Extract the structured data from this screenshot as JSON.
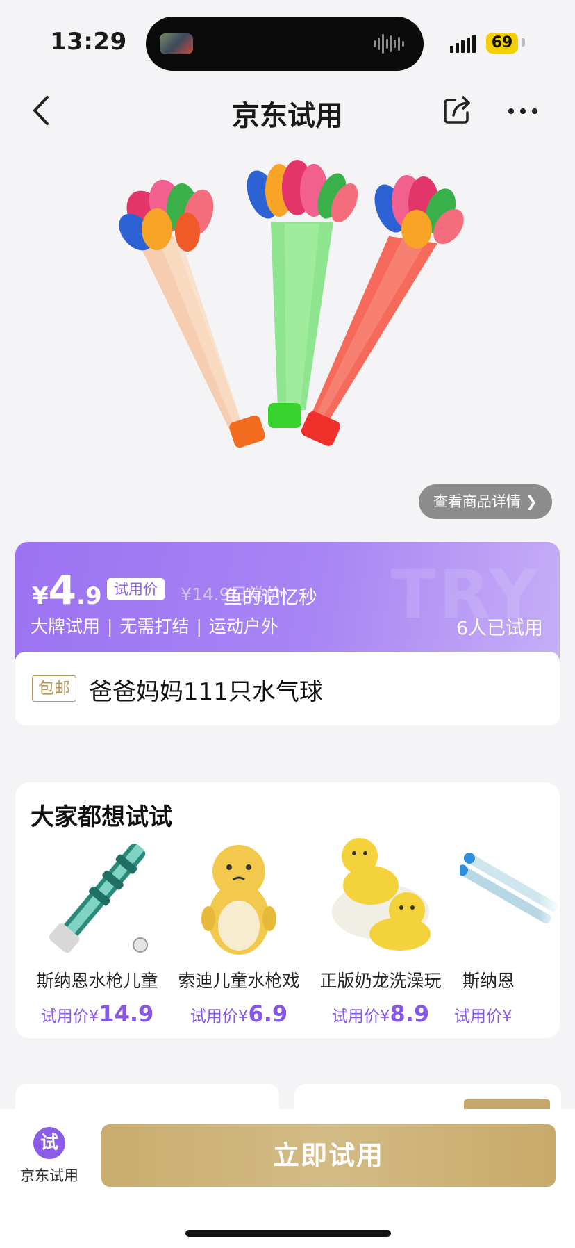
{
  "status_bar": {
    "time": "13:29",
    "battery": "69"
  },
  "nav": {
    "title": "京东试用"
  },
  "hero": {
    "details_label": "查看商品详情 ❯"
  },
  "price_banner": {
    "currency": "¥",
    "price_int": "4",
    "price_dec": ".9",
    "trial_tag": "试用价",
    "original_price": "¥14.9日常价",
    "overlay_text": "鱼的记忆秒",
    "watermark": "TRY",
    "tags": [
      "大牌试用",
      "无需打结",
      "运动户外"
    ],
    "separator": "|",
    "tried_count": "6人已试用"
  },
  "product": {
    "shipping_tag": "包邮",
    "title": "爸爸妈妈111只水气球"
  },
  "recommendations": {
    "title": "大家都想试试",
    "items": [
      {
        "name": "斯纳恩水枪儿童",
        "price_label": "试用价¥",
        "price": "14.9"
      },
      {
        "name": "索迪儿童水枪戏",
        "price_label": "试用价¥",
        "price": "6.9"
      },
      {
        "name": "正版奶龙洗澡玩",
        "price_label": "试用价¥",
        "price": "8.9"
      },
      {
        "name": "斯纳恩",
        "price_label": "试用价¥",
        "price": ""
      }
    ]
  },
  "bottom_bar": {
    "tab_icon_char": "试",
    "tab_label": "京东试用",
    "cta_label": "立即试用"
  },
  "colors": {
    "accent_purple": "#9c72f2",
    "gold": "#c9ad6e",
    "price_purple": "#8656e6"
  }
}
